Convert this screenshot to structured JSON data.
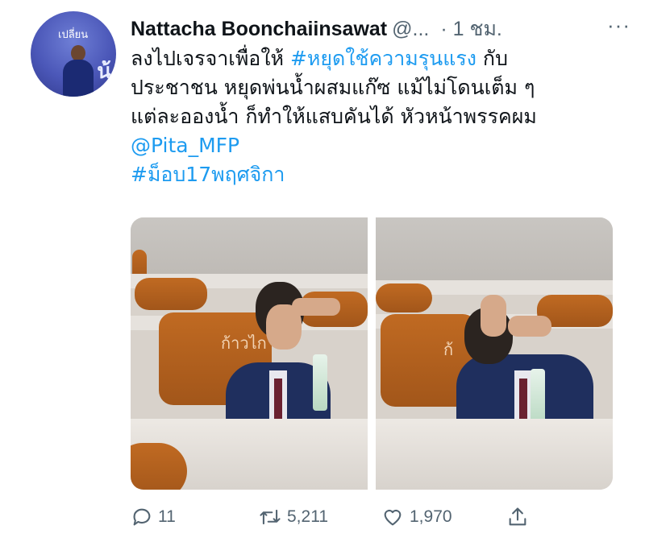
{
  "author": {
    "name": "Nattacha Boonchaiinsawat",
    "handle": "@...",
    "time": "· 1 ชม.",
    "avatar_text": "เปลี่ยน",
    "avatar_text2": "น้"
  },
  "menu_glyph": "···",
  "tweet": {
    "line1_prefix": "ลงไปเจรจาเพื่อให้ ",
    "hashtag1": "#หยุดใช้ความรุนแรง",
    "line1_suffix": " กับ",
    "line2": "ประชาชน หยุดพ่นน้ำผสมแก๊ซ แม้ไม่โดนเต็ม ๆ",
    "line3": "แต่ละอองน้ำ ก็ทำให้แสบคันได้ หัวหน้าพรรคผม",
    "mention": "@Pita_MFP",
    "hashtag2": "#ม็อบ17พฤศจิกา"
  },
  "media": {
    "seat_label_left": "ก้าวไก",
    "seat_label_right": "ก้"
  },
  "actions": {
    "replies": "11",
    "retweets": "5,211",
    "likes": "1,970"
  },
  "colors": {
    "link": "#1d9bf0",
    "muted": "#536471",
    "text": "#0f1419"
  }
}
